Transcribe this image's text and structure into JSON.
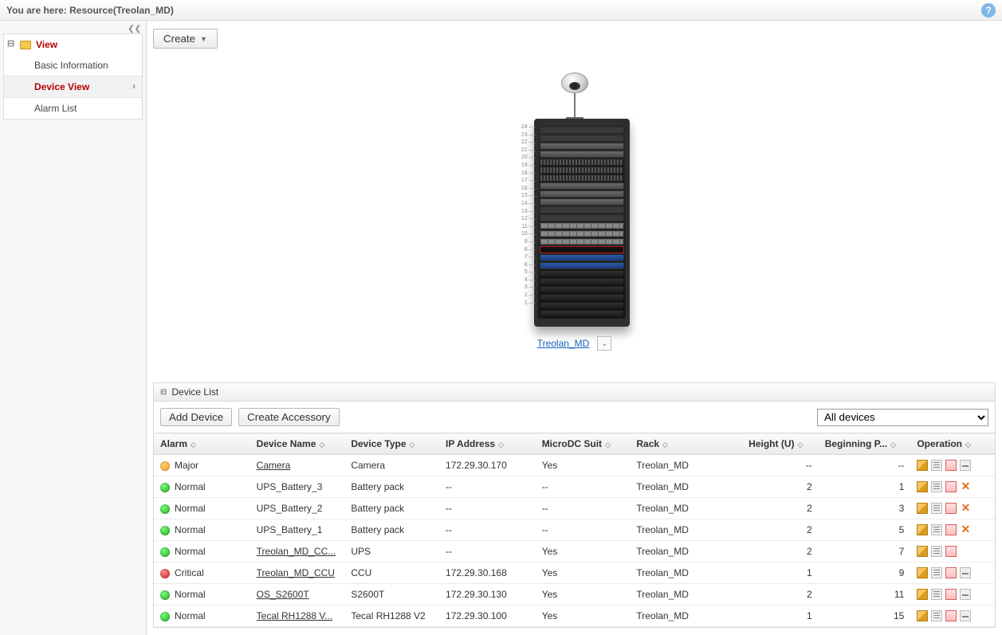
{
  "breadcrumb": "You are here: Resource(Treolan_MD)",
  "help_tooltip": "?",
  "sidebar": {
    "root": "View",
    "items": [
      {
        "label": "Basic Information",
        "active": false
      },
      {
        "label": "Device View",
        "active": true
      },
      {
        "label": "Alarm List",
        "active": false
      }
    ]
  },
  "toolbar": {
    "create": "Create"
  },
  "rack": {
    "name": "Treolan_MD",
    "u_count": 24,
    "slots": [
      "ups",
      "ups",
      "ups",
      "ups",
      "ups",
      "ups",
      "blue",
      "blue",
      "ccu",
      "disk",
      "disk",
      "disk",
      "empty",
      "empty",
      "server",
      "server",
      "server",
      "switch",
      "switch",
      "switch",
      "server",
      "server",
      "empty",
      "empty"
    ]
  },
  "panel": {
    "title": "Device List",
    "buttons": {
      "add": "Add Device",
      "accessory": "Create Accessory"
    },
    "filter": {
      "selected": "All devices"
    },
    "columns": [
      "Alarm",
      "Device Name",
      "Device Type",
      "IP Address",
      "MicroDC Suit",
      "Rack",
      "Height (U)",
      "Beginning P...",
      "Operation"
    ],
    "rows": [
      {
        "alarm": "Major",
        "status": "major",
        "name": "Camera",
        "link": true,
        "type": "Camera",
        "ip": "172.29.30.170",
        "suit": "Yes",
        "rack": "Treolan_MD",
        "h": "--",
        "bp": "--",
        "ops": [
          "edit",
          "props",
          "move",
          "del"
        ]
      },
      {
        "alarm": "Normal",
        "status": "normal",
        "name": "UPS_Battery_3",
        "link": false,
        "type": "Battery pack",
        "ip": "--",
        "suit": "--",
        "rack": "Treolan_MD",
        "h": "2",
        "bp": "1",
        "ops": [
          "edit",
          "props",
          "move",
          "x"
        ]
      },
      {
        "alarm": "Normal",
        "status": "normal",
        "name": "UPS_Battery_2",
        "link": false,
        "type": "Battery pack",
        "ip": "--",
        "suit": "--",
        "rack": "Treolan_MD",
        "h": "2",
        "bp": "3",
        "ops": [
          "edit",
          "props",
          "move",
          "x"
        ]
      },
      {
        "alarm": "Normal",
        "status": "normal",
        "name": "UPS_Battery_1",
        "link": false,
        "type": "Battery pack",
        "ip": "--",
        "suit": "--",
        "rack": "Treolan_MD",
        "h": "2",
        "bp": "5",
        "ops": [
          "edit",
          "props",
          "move",
          "x"
        ]
      },
      {
        "alarm": "Normal",
        "status": "normal",
        "name": "Treolan_MD_CC...",
        "link": true,
        "type": "UPS",
        "ip": "--",
        "suit": "Yes",
        "rack": "Treolan_MD",
        "h": "2",
        "bp": "7",
        "ops": [
          "edit",
          "props",
          "move"
        ]
      },
      {
        "alarm": "Critical",
        "status": "critical",
        "name": "Treolan_MD_CCU",
        "link": true,
        "type": "CCU",
        "ip": "172.29.30.168",
        "suit": "Yes",
        "rack": "Treolan_MD",
        "h": "1",
        "bp": "9",
        "ops": [
          "edit",
          "props",
          "move",
          "del"
        ]
      },
      {
        "alarm": "Normal",
        "status": "normal",
        "name": "OS_S2600T",
        "link": true,
        "type": "S2600T",
        "ip": "172.29.30.130",
        "suit": "Yes",
        "rack": "Treolan_MD",
        "h": "2",
        "bp": "11",
        "ops": [
          "edit",
          "props",
          "move",
          "del"
        ]
      },
      {
        "alarm": "Normal",
        "status": "normal",
        "name": "Tecal RH1288 V...",
        "link": true,
        "type": "Tecal RH1288 V2",
        "ip": "172.29.30.100",
        "suit": "Yes",
        "rack": "Treolan_MD",
        "h": "1",
        "bp": "15",
        "ops": [
          "edit",
          "props",
          "move",
          "del"
        ]
      }
    ]
  }
}
